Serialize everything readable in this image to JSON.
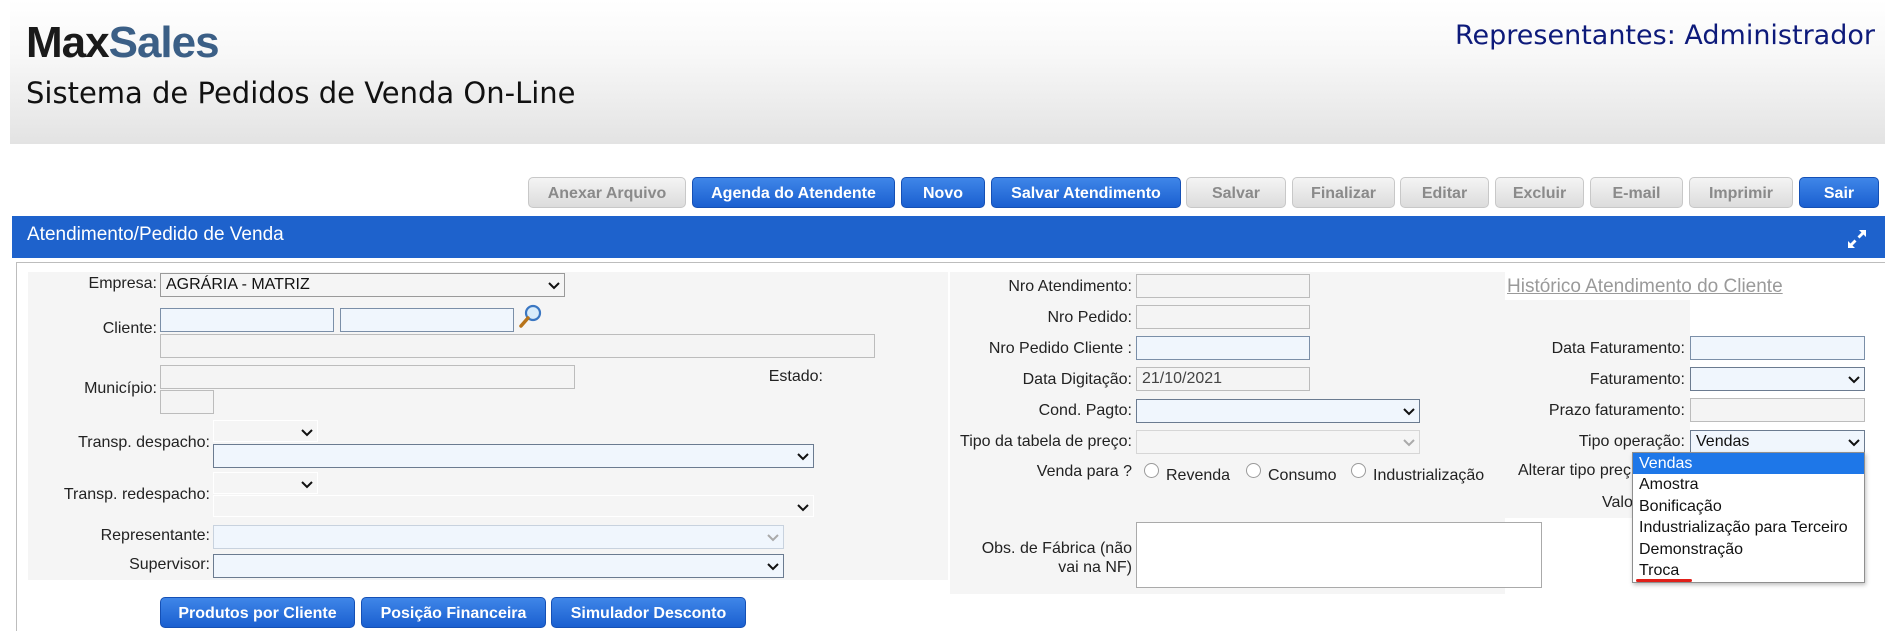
{
  "header": {
    "logo_max": "Max",
    "logo_sales": "Sales",
    "system_title": "Sistema de Pedidos de Venda On-Line",
    "user_label": "Representantes: Administrador"
  },
  "toolbar": {
    "anexar": "Anexar Arquivo",
    "agenda": "Agenda do Atendente",
    "novo": "Novo",
    "salvar_atendimento": "Salvar Atendimento",
    "salvar": "Salvar",
    "finalizar": "Finalizar",
    "editar": "Editar",
    "excluir": "Excluir",
    "email": "E-mail",
    "imprimir": "Imprimir",
    "sair": "Sair"
  },
  "panel": {
    "title": "Atendimento/Pedido de Venda"
  },
  "left_form": {
    "empresa_label": "Empresa:",
    "empresa_value": "AGRÁRIA - MATRIZ",
    "cliente_label": "Cliente:",
    "municipio_label": "Município:",
    "estado_label": "Estado:",
    "transp_despacho_label": "Transp. despacho:",
    "transp_redespacho_label": "Transp. redespacho:",
    "representante_label": "Representante:",
    "supervisor_label": "Supervisor:"
  },
  "middle_form": {
    "nro_atendimento_label": "Nro Atendimento:",
    "nro_pedido_label": "Nro Pedido:",
    "nro_pedido_cliente_label": "Nro Pedido Cliente :",
    "data_digitacao_label": "Data Digitação:",
    "data_digitacao_value": "21/10/2021",
    "cond_pagto_label": "Cond. Pagto:",
    "tipo_tabela_label": "Tipo da tabela de preço:",
    "venda_para_label": "Venda para ?",
    "radio_revenda": "Revenda",
    "radio_consumo": "Consumo",
    "radio_industrializacao": "Industrialização",
    "obs_label_1": "Obs. de Fábrica (não",
    "obs_label_2": "vai na NF)"
  },
  "right_form": {
    "historico_link": "Histórico Atendimento do Cliente",
    "data_faturamento_label": "Data Faturamento:",
    "faturamento_label": "Faturamento:",
    "prazo_faturamento_label": "Prazo faturamento:",
    "tipo_operacao_label": "Tipo operação:",
    "tipo_operacao_value": "Vendas",
    "alterar_tipo_label": "Alterar tipo preç",
    "valor_label": "Valo"
  },
  "tipo_operacao_options": [
    "Vendas",
    "Amostra",
    "Bonificação",
    "Industrialização para Terceiro",
    "Demonstração",
    "Troca"
  ],
  "bottom_buttons": {
    "produtos": "Produtos por Cliente",
    "posicao": "Posição Financeira",
    "simulador": "Simulador Desconto"
  },
  "colors": {
    "primary_button": "#1a5fd0",
    "panel_bar": "#1e62cc",
    "selected_option": "#1e77e8",
    "user_label": "#0d1a7a"
  }
}
